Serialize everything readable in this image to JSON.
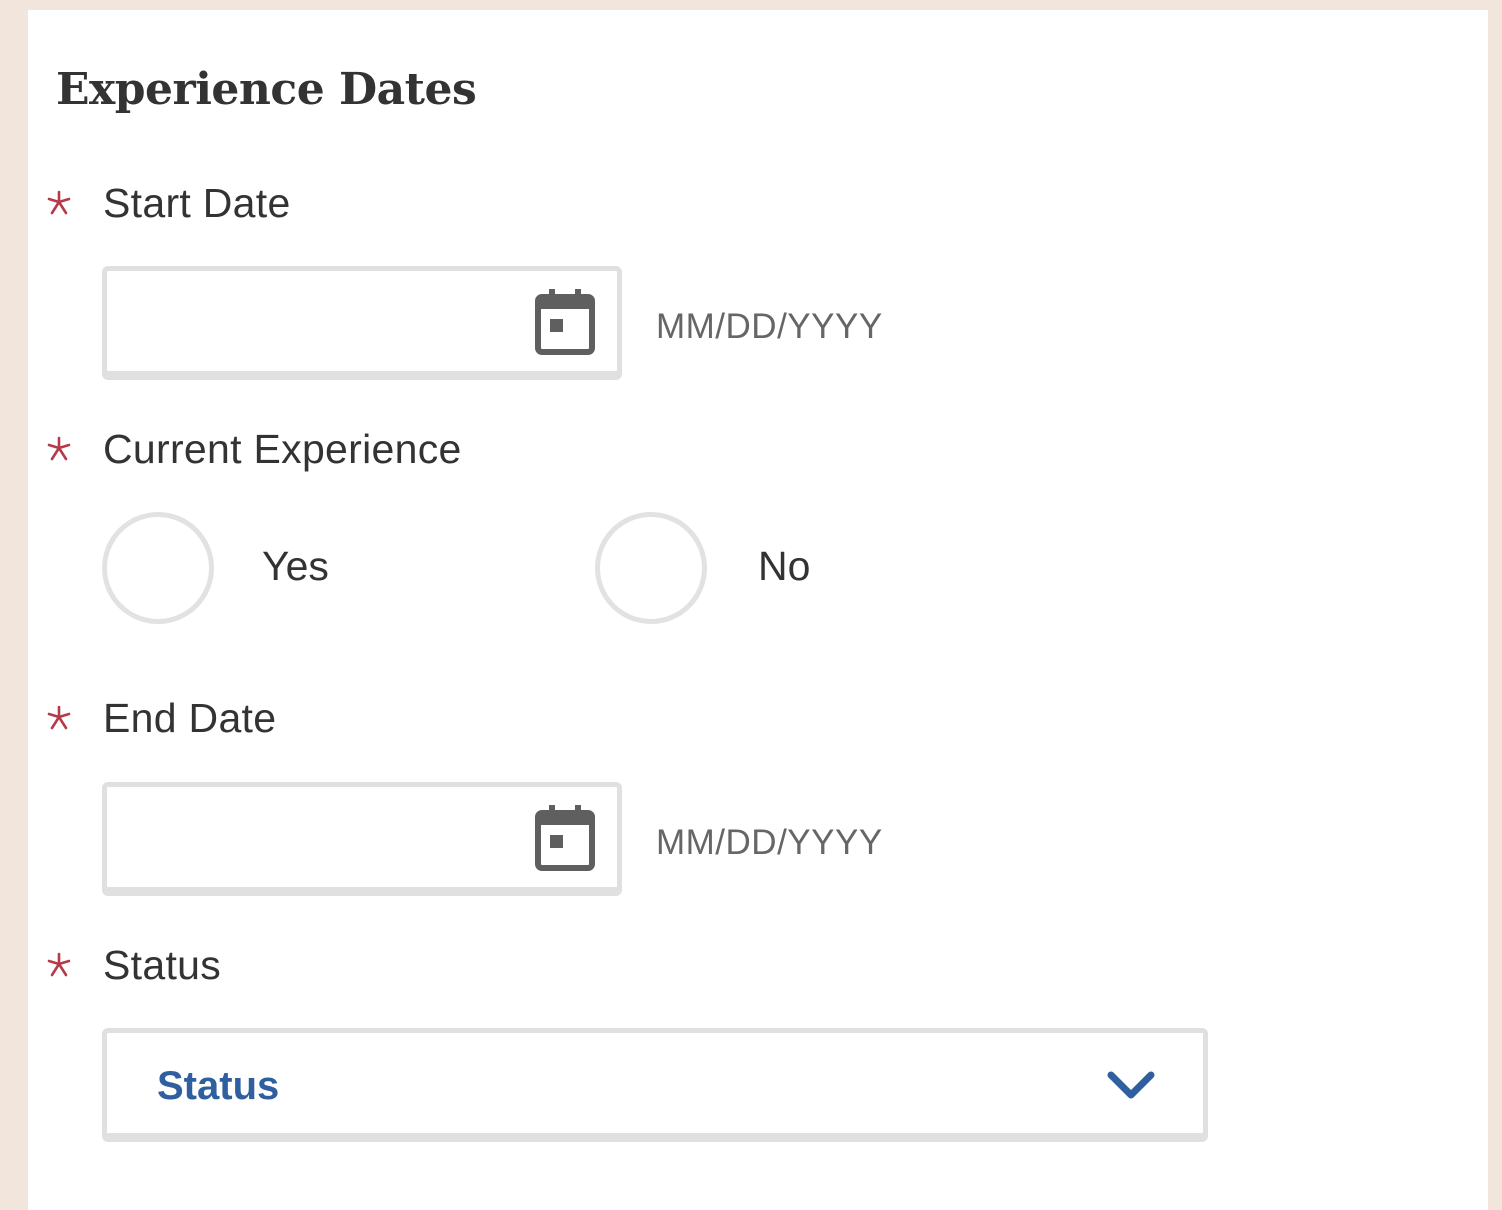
{
  "section": {
    "title": "Experience Dates"
  },
  "fields": {
    "start_date": {
      "label": "Start Date",
      "value": "",
      "format_hint": "MM/DD/YYYY",
      "icon": "calendar-icon"
    },
    "current_experience": {
      "label": "Current Experience",
      "options": [
        "Yes",
        "No"
      ],
      "selected": null
    },
    "end_date": {
      "label": "End Date",
      "value": "",
      "format_hint": "MM/DD/YYYY",
      "icon": "calendar-icon"
    },
    "status": {
      "label": "Status",
      "selected_text": "Status",
      "icon": "chevron-down-icon"
    }
  },
  "required_marker": "asterisk-icon",
  "colors": {
    "background": "#f2e6dc",
    "panel": "#ffffff",
    "required": "#b53a4a",
    "text": "#333333",
    "hint": "#666666",
    "border": "#e0e0e0",
    "icon": "#5f5f5f",
    "select_text": "#2f5f9f"
  }
}
